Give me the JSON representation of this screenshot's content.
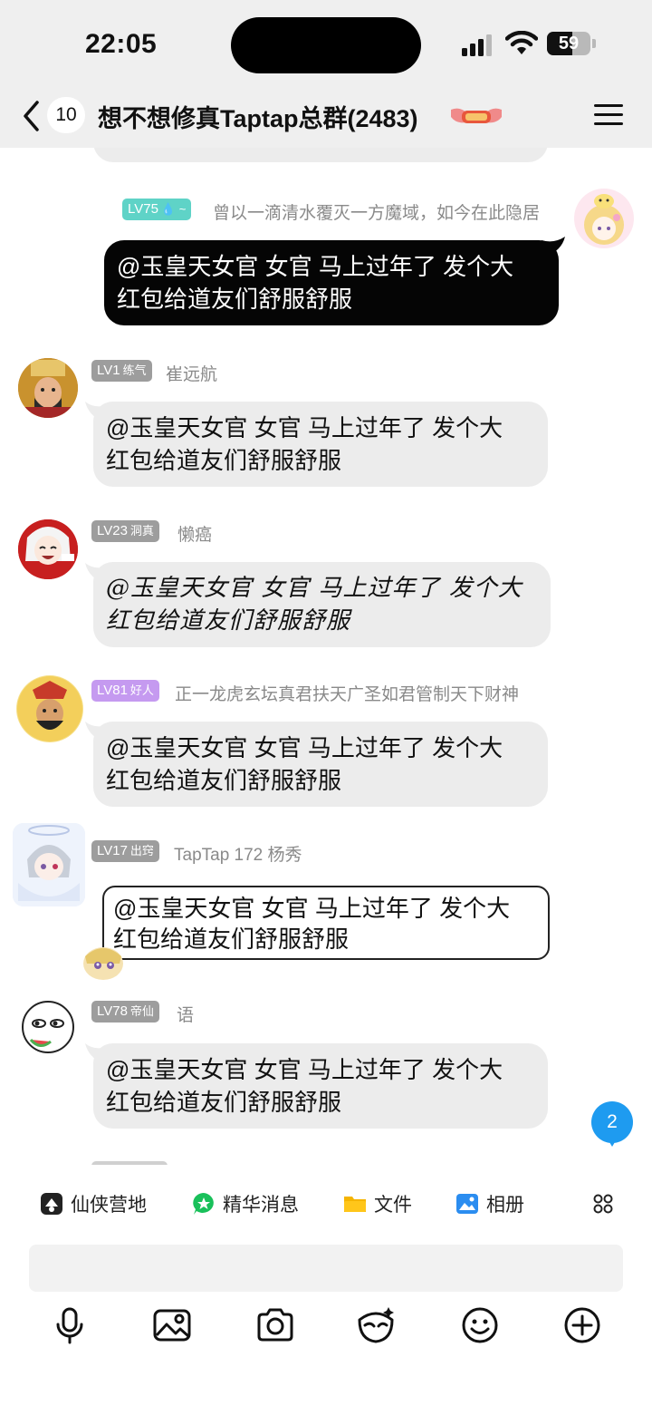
{
  "status_bar": {
    "time": "22:05",
    "battery": "59",
    "battery_level": 0.59
  },
  "header": {
    "unread_count": "10",
    "title": "想不想修真Taptap总群(2483)"
  },
  "messages": [
    {
      "side": "right",
      "level": "LV75",
      "rank": "💧 ~",
      "level_color": "#5fd3c7",
      "nickname": "曾以一滴清水覆灭一方魔域，如今在此隐居",
      "text_line1": "@玉皇天女官 女官 马上过年了 发个大",
      "text_line2": "红包给道友们舒服舒服",
      "bubble_style": "dark"
    },
    {
      "side": "left",
      "level": "LV1",
      "rank": "练气",
      "level_color": "#9d9d9d",
      "nickname": "崔远航",
      "text_line1": "@玉皇天女官 女官 马上过年了 发个大",
      "text_line2": "红包给道友们舒服舒服",
      "bubble_style": "plain"
    },
    {
      "side": "left",
      "level": "LV23",
      "rank": "洞真",
      "level_color": "#9d9d9d",
      "nickname": "懒癌",
      "text_line1": "@玉皇天女官 女官 马上过年了 发个大",
      "text_line2": "红包给道友们舒服舒服",
      "bubble_style": "script"
    },
    {
      "side": "left",
      "level": "LV81",
      "rank": "好人",
      "level_color": "#c59af0",
      "nickname": "正一龙虎玄坛真君扶天广圣如君管制天下财神",
      "text_line1": "@玉皇天女官 女官 马上过年了 发个大",
      "text_line2": "红包给道友们舒服舒服",
      "bubble_style": "plain"
    },
    {
      "side": "left",
      "level": "LV17",
      "rank": "出窍",
      "level_color": "#9d9d9d",
      "nickname": "TapTap 172 杨秀",
      "text_line1": "@玉皇天女官 女官 马上过年了 发个大",
      "text_line2": "红包给道友们舒服舒服",
      "bubble_style": "outlined"
    },
    {
      "side": "left",
      "level": "LV78",
      "rank": "帝仙",
      "level_color": "#9d9d9d",
      "nickname": "语",
      "text_line1": "@玉皇天女官 女官 马上过年了 发个大",
      "text_line2": "红包给道友们舒服舒服",
      "bubble_style": "plain"
    }
  ],
  "new_message_count": "2",
  "quick_bar": [
    {
      "icon": "camp-icon",
      "label": "仙侠营地"
    },
    {
      "icon": "highlight-icon",
      "label": "精华消息"
    },
    {
      "icon": "folder-icon",
      "label": "文件"
    },
    {
      "icon": "album-icon",
      "label": "相册"
    }
  ],
  "toolbar": [
    "microphone-icon",
    "image-icon",
    "camera-icon",
    "sticker-icon",
    "emoji-icon",
    "plus-icon"
  ]
}
